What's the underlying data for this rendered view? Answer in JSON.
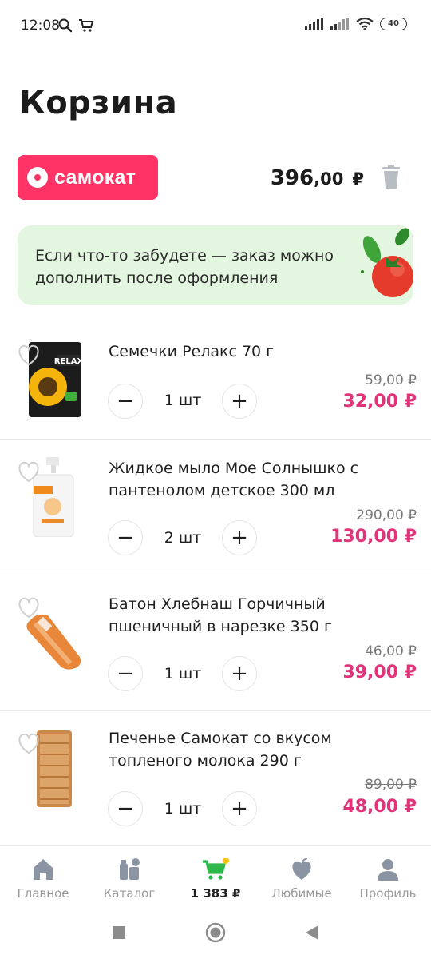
{
  "status_bar": {
    "time": "12:08",
    "battery": "40"
  },
  "header": {
    "title": "Корзина"
  },
  "store": {
    "name": "самокат",
    "total_rub": "396",
    "total_kop": ",00",
    "currency": "₽",
    "brand_color": "#ff3365"
  },
  "banner": {
    "text": "Если что-то забудете — заказ можно дополнить после оформления"
  },
  "items": [
    {
      "name": "Семечки Релакс 70 г",
      "qty": "1 шт",
      "old_price": "59,00 ₽",
      "price": "32,00 ₽",
      "image": "sunflower-seeds-pack"
    },
    {
      "name": "Жидкое мыло Мое Солнышко с пантенолом детское 300 мл",
      "qty": "2 шт",
      "old_price": "290,00 ₽",
      "price": "130,00 ₽",
      "image": "liquid-soap-bottle"
    },
    {
      "name": "Батон Хлебнаш Горчичный пшеничный в нарезке 350 г",
      "qty": "1 шт",
      "old_price": "46,00 ₽",
      "price": "39,00 ₽",
      "image": "bread-loaf-pack"
    },
    {
      "name": "Печенье Самокат со вкусом топленого молока 290 г",
      "qty": "1 шт",
      "old_price": "89,00 ₽",
      "price": "48,00 ₽",
      "image": "cookies-pack"
    }
  ],
  "stepper": {
    "minus": "−",
    "plus": "+"
  },
  "bottom_nav": {
    "home": "Главное",
    "catalog": "Каталог",
    "cart": "1 383 ₽",
    "favorites": "Любимые",
    "profile": "Профиль"
  },
  "colors": {
    "price_accent": "#e0337a",
    "banner_bg": "#e3f6df",
    "cart_icon": "#2eb84b"
  }
}
